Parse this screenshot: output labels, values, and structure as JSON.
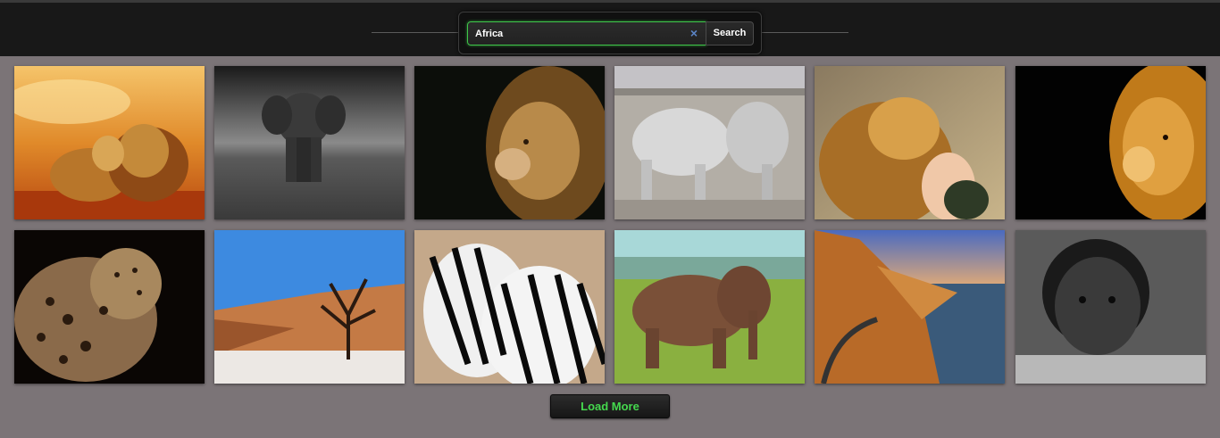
{
  "search": {
    "value": "Africa",
    "clear_icon": "×",
    "button_label": "Search"
  },
  "gallery": {
    "items": [
      {
        "subject": "lions-sunset"
      },
      {
        "subject": "elephant-bw"
      },
      {
        "subject": "lion-dark"
      },
      {
        "subject": "elephants-pair"
      },
      {
        "subject": "lion-girl"
      },
      {
        "subject": "lion-black"
      },
      {
        "subject": "leopard"
      },
      {
        "subject": "dead-tree-dunes"
      },
      {
        "subject": "zebras"
      },
      {
        "subject": "elephant-grass"
      },
      {
        "subject": "coastal-road"
      },
      {
        "subject": "boy-portrait"
      }
    ]
  },
  "load_more_label": "Load More",
  "colors": {
    "background": "#7b7477",
    "topbar": "#181818",
    "accent_green": "#3fc54a",
    "load_more_text": "#45d84e"
  }
}
